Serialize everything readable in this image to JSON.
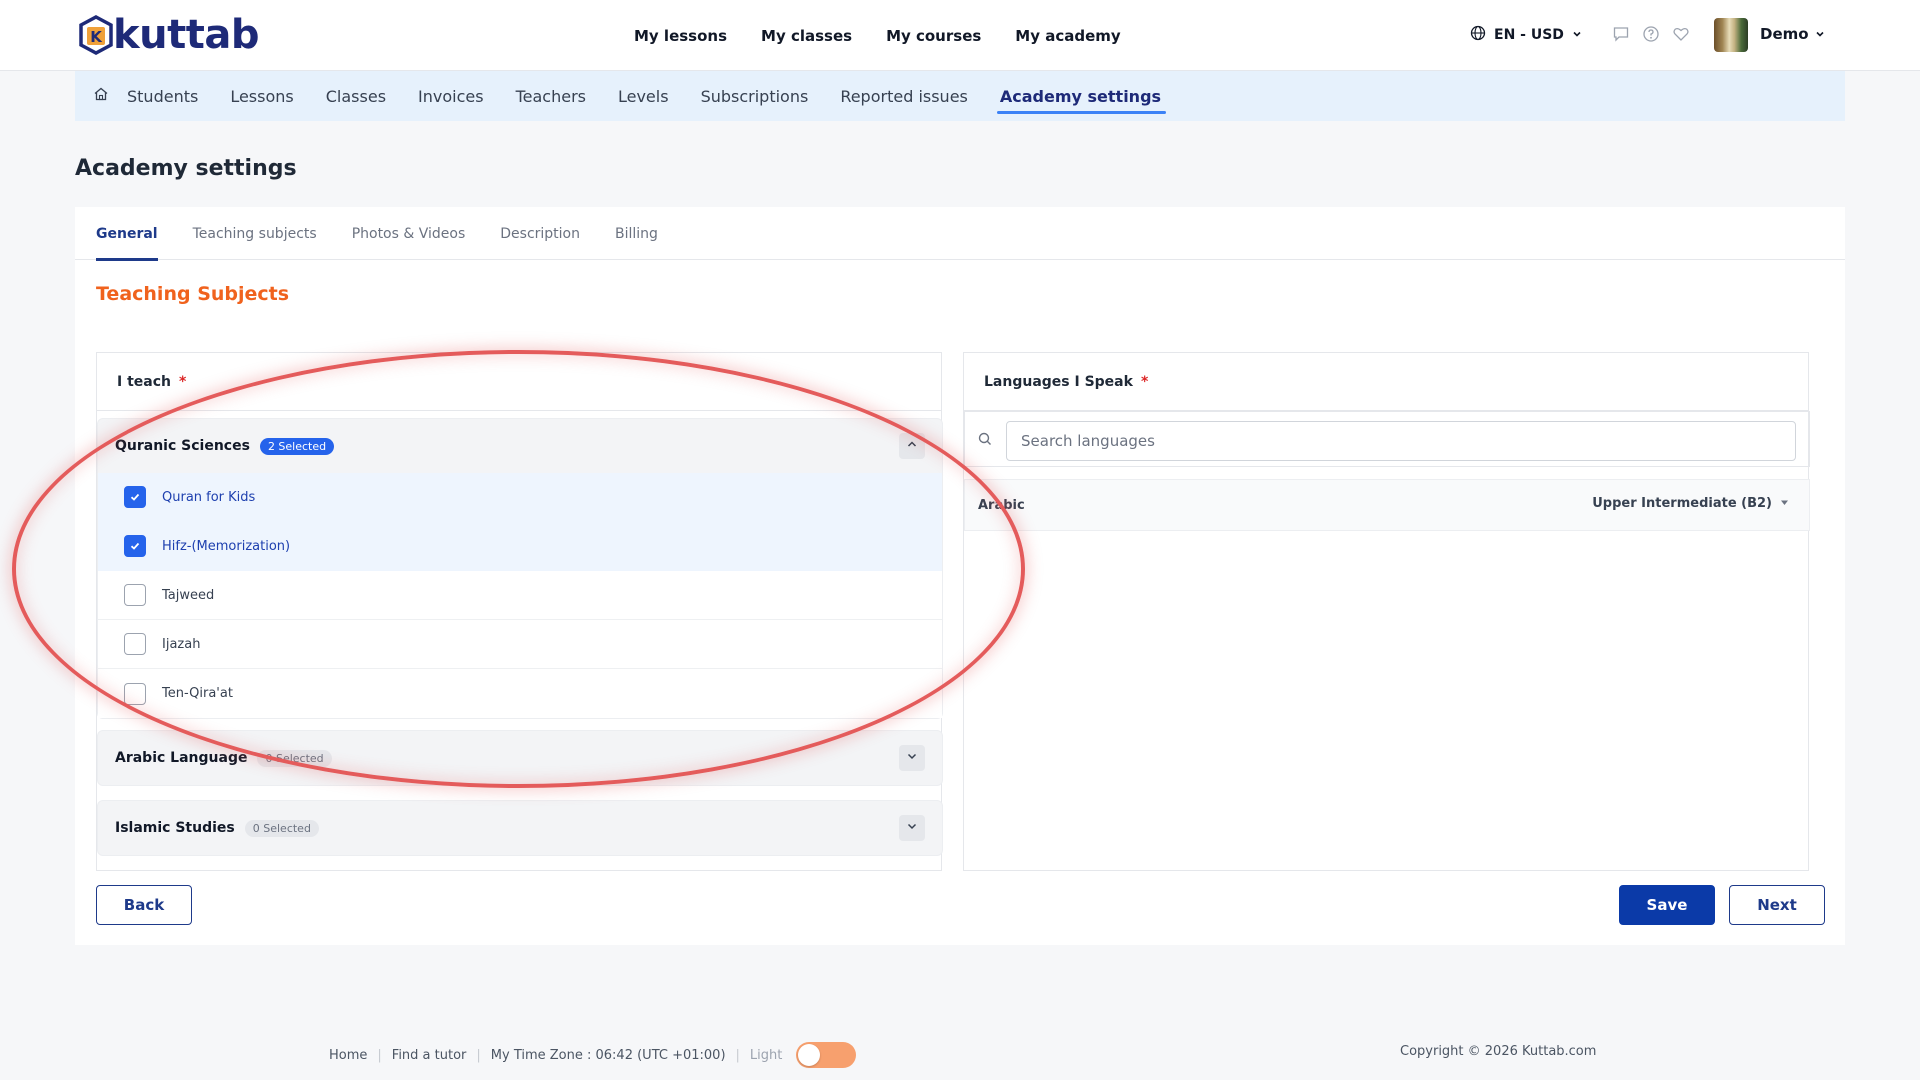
{
  "app": {
    "logo_text": "kuttab",
    "logo_letter": "K"
  },
  "topnav": {
    "items": [
      "My lessons",
      "My classes",
      "My courses",
      "My academy"
    ],
    "language": "EN - USD",
    "user_name": "Demo"
  },
  "subnav": {
    "items": [
      "Students",
      "Lessons",
      "Classes",
      "Invoices",
      "Teachers",
      "Levels",
      "Subscriptions",
      "Reported issues",
      "Academy settings"
    ],
    "active": "Academy settings"
  },
  "page": {
    "title": "Academy settings"
  },
  "settings_tabs": {
    "items": [
      "General",
      "Teaching subjects",
      "Photos & Videos",
      "Description",
      "Billing"
    ],
    "active": "General"
  },
  "section_title": "Teaching Subjects",
  "teach_panel": {
    "label": "I teach",
    "required_mark": "*",
    "groups": [
      {
        "name": "Quranic Sciences",
        "badge": "2 Selected",
        "expanded": true,
        "items": [
          {
            "label": "Quran for Kids",
            "checked": true
          },
          {
            "label": "Hifz-(Memorization)",
            "checked": true
          },
          {
            "label": "Tajweed",
            "checked": false
          },
          {
            "label": "Ijazah",
            "checked": false
          },
          {
            "label": "Ten-Qira'at",
            "checked": false
          }
        ]
      },
      {
        "name": "Arabic Language",
        "badge": "0 Selected",
        "expanded": false
      },
      {
        "name": "Islamic Studies",
        "badge": "0 Selected",
        "expanded": false
      }
    ]
  },
  "languages_panel": {
    "label": "Languages I Speak",
    "required_mark": "*",
    "search_placeholder": "Search languages",
    "rows": [
      {
        "language": "Arabic",
        "level": "Upper Intermediate (B2)"
      }
    ]
  },
  "buttons": {
    "back": "Back",
    "save": "Save",
    "next": "Next"
  },
  "footer": {
    "home": "Home",
    "find_tutor": "Find a tutor",
    "timezone": "My Time Zone : 06:42 (UTC +01:00)",
    "theme_label": "Light",
    "copyright": "Copyright © 2026 Kuttab.com"
  },
  "colors": {
    "brand_navy": "#1e2a78",
    "accent_orange": "#f0621d",
    "primary_blue": "#0b3aa8",
    "checkbox_blue": "#2563eb",
    "annotation_red": "#e45b5b"
  }
}
